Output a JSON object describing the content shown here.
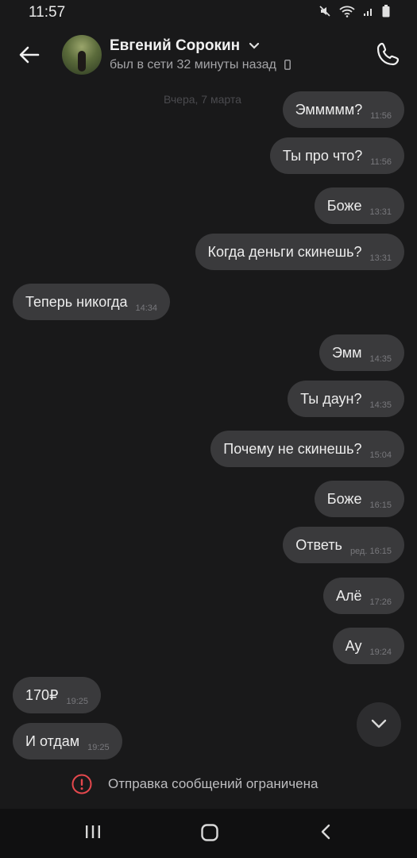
{
  "status_bar": {
    "time": "11:57"
  },
  "header": {
    "name": "Евгений Сорокин",
    "status": "был в сети 32 минуты назад"
  },
  "chat": {
    "date_separator": "Вчера, 7 марта",
    "messages": [
      {
        "text": "Эммммм?",
        "meta": "11:56",
        "direction": "out"
      },
      {
        "text": "Ты про что?",
        "meta": "11:56",
        "direction": "out"
      },
      {
        "text": "Боже",
        "meta": "13:31",
        "direction": "out"
      },
      {
        "text": "Когда деньги скинешь?",
        "meta": "13:31",
        "direction": "out"
      },
      {
        "text": "Теперь никогда",
        "meta": "14:34",
        "direction": "in"
      },
      {
        "text": "Эмм",
        "meta": "14:35",
        "direction": "out"
      },
      {
        "text": "Ты даун?",
        "meta": "14:35",
        "direction": "out"
      },
      {
        "text": "Почему не скинешь?",
        "meta": "15:04",
        "direction": "out"
      },
      {
        "text": "Боже",
        "meta": "16:15",
        "direction": "out"
      },
      {
        "text": "Ответь",
        "meta": "ред. 16:15",
        "direction": "out"
      },
      {
        "text": "Алё",
        "meta": "17:26",
        "direction": "out"
      },
      {
        "text": "Ау",
        "meta": "19:24",
        "direction": "out"
      },
      {
        "text": "170₽",
        "meta": "19:25",
        "direction": "in"
      },
      {
        "text": "И отдам",
        "meta": "19:25",
        "direction": "in"
      }
    ]
  },
  "footer": {
    "restriction_text": "Отправка сообщений ограничена"
  },
  "colors": {
    "background": "#19191a",
    "bubble": "#3a3a3c",
    "warning": "#e5484d"
  },
  "icons": [
    "back-arrow-icon",
    "chevron-down-icon",
    "phone-icon",
    "mobile-device-icon",
    "scroll-down-icon",
    "warning-icon",
    "recent-apps-icon",
    "home-icon",
    "nav-back-icon"
  ]
}
